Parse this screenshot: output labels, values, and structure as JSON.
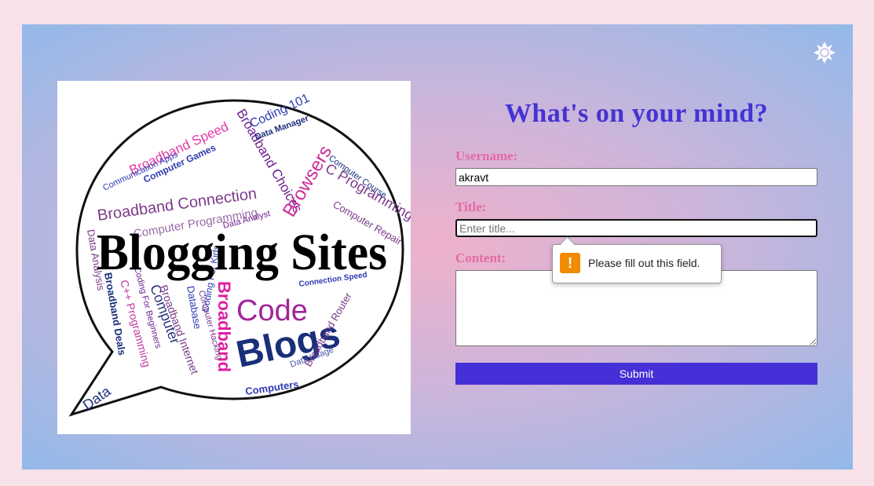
{
  "hero_image": {
    "headline": "Blogging Sites",
    "words": [
      "Broadband Speed",
      "Broadband Connection",
      "Computer Programming",
      "Broadband Choices",
      "Browsers",
      "C Programming",
      "Code",
      "Blogs",
      "Broadband",
      "Computer",
      "C++ Programming",
      "Broadband Deals",
      "Data",
      "Coding 101",
      "Computer Games",
      "Data Analyst",
      "Coding For Beginners",
      "Computers",
      "Data Usage",
      "Broadband Router",
      "Connection Speed",
      "Computer Repair",
      "Communication Apps",
      "Database",
      "Computer Hacking",
      "Broadband Internet",
      "Coding For Kids",
      "Data Analysis",
      "Computer Course",
      "Data Manager"
    ]
  },
  "form": {
    "heading": "What's on your mind?",
    "username_label": "Username:",
    "username_value": "akravt",
    "title_label": "Title:",
    "title_placeholder": "Enter title...",
    "content_label": "Content:",
    "content_value": "",
    "submit_label": "Submit"
  },
  "validation_tooltip": {
    "icon": "warning-icon",
    "text": "Please fill out this field."
  },
  "theme_toggle": {
    "icon": "sun-icon"
  },
  "colors": {
    "page_bg": "#f7e2ea",
    "heading": "#4533d3",
    "labels": "#e26aa6",
    "submit_bg": "#4430d6",
    "warning": "#f28b00"
  }
}
